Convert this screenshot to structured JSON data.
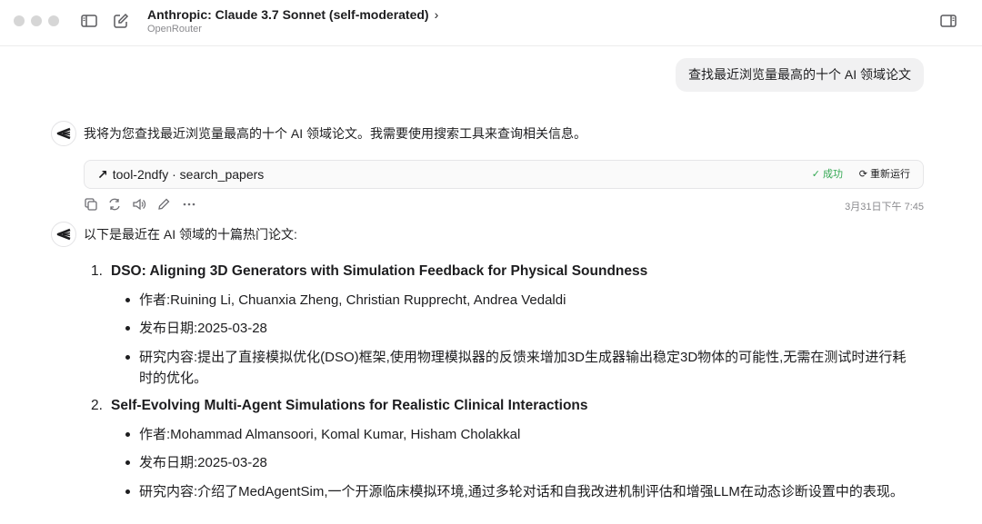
{
  "window": {
    "title": "Anthropic: Claude 3.7 Sonnet (self-moderated)",
    "title_chevron": "›",
    "subtitle": "OpenRouter"
  },
  "icons": {
    "sidebar_toggle": "sidebar-toggle-icon",
    "new_chat": "compose-icon",
    "panel_toggle": "right-panel-icon",
    "assistant_avatar": "claude-logo-icon"
  },
  "user_message": "查找最近浏览量最高的十个 AI 领域论文",
  "assistant_intro": "我将为您查找最近浏览量最高的十个 AI 领域论文。我需要使用搜索工具来查询相关信息。",
  "tool_call": {
    "name": "tool-2ndfy · search_papers",
    "status": "成功",
    "rerun": "重新运行"
  },
  "message_actions": {
    "timestamp": "3月31日下午 7:45"
  },
  "assistant_reply": {
    "intro": "以下是最近在 AI 领域的十篇热门论文:",
    "papers": [
      {
        "num": "1.",
        "title": "DSO: Aligning 3D Generators with Simulation Feedback for Physical Soundness",
        "authors": "作者:Ruining Li, Chuanxia Zheng, Christian Rupprecht, Andrea Vedaldi",
        "date": "发布日期:2025-03-28",
        "content": "研究内容:提出了直接模拟优化(DSO)框架,使用物理模拟器的反馈来增加3D生成器输出稳定3D物体的可能性,无需在测试时进行耗时的优化。"
      },
      {
        "num": "2.",
        "title": "Self-Evolving Multi-Agent Simulations for Realistic Clinical Interactions",
        "authors": "作者:Mohammad Almansoori, Komal Kumar, Hisham Cholakkal",
        "date": "发布日期:2025-03-28",
        "content": "研究内容:介绍了MedAgentSim,一个开源临床模拟环境,通过多轮对话和自我改进机制评估和增强LLM在动态诊断设置中的表现。"
      }
    ]
  },
  "colors": {
    "success": "#34a853",
    "bubble": "#f1f1f2",
    "traffic": "#d6d6d6"
  }
}
